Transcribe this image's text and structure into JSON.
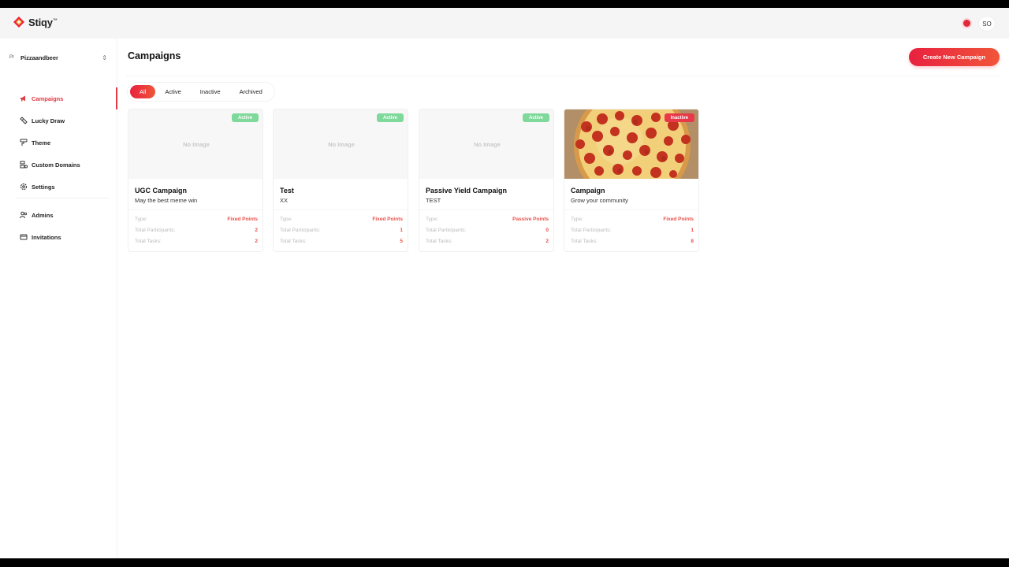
{
  "app": {
    "name": "Stiqy",
    "trademark": "™"
  },
  "topbar": {
    "avatar_initials": "SO"
  },
  "sidebar": {
    "org": {
      "initial": "PI",
      "name": "Pizzaandbeer"
    },
    "items": [
      {
        "label": "Campaigns",
        "icon": "megaphone-icon",
        "active": true
      },
      {
        "label": "Lucky Draw",
        "icon": "ticket-icon"
      },
      {
        "label": "Theme",
        "icon": "paint-roller-icon"
      },
      {
        "label": "Custom Domains",
        "icon": "domain-icon"
      },
      {
        "label": "Settings",
        "icon": "gear-icon"
      },
      {
        "label": "Admins",
        "icon": "users-icon"
      },
      {
        "label": "Invitations",
        "icon": "invitation-card-icon"
      }
    ]
  },
  "main": {
    "title": "Campaigns",
    "create_label": "Create New Campaign",
    "tabs": [
      "All",
      "Active",
      "Inactive",
      "Archived"
    ],
    "active_tab": "All",
    "stat_labels": {
      "type": "Type:",
      "participants": "Total Participants:",
      "tasks": "Total Tasks:"
    },
    "no_image_label": "No Image",
    "cards": [
      {
        "title": "UGC Campaign",
        "subtitle": "May the best meme win",
        "status": "Active",
        "type": "Fixed Points",
        "participants": "2",
        "tasks": "2",
        "image": "none"
      },
      {
        "title": "Test",
        "subtitle": "XX",
        "status": "Active",
        "type": "Fixed Points",
        "participants": "1",
        "tasks": "5",
        "image": "none"
      },
      {
        "title": "Passive Yield Campaign",
        "subtitle": "TEST",
        "status": "Active",
        "type": "Passive Points",
        "participants": "0",
        "tasks": "2",
        "image": "none"
      },
      {
        "title": "Campaign",
        "subtitle": "Grow your community",
        "status": "Inactive",
        "type": "Fixed Points",
        "participants": "1",
        "tasks": "8",
        "image": "pepperoni-pizza"
      }
    ]
  },
  "colors": {
    "accent": "#e13a44",
    "active_badge": "#7ed99a",
    "inactive_badge": "#e8384a"
  }
}
